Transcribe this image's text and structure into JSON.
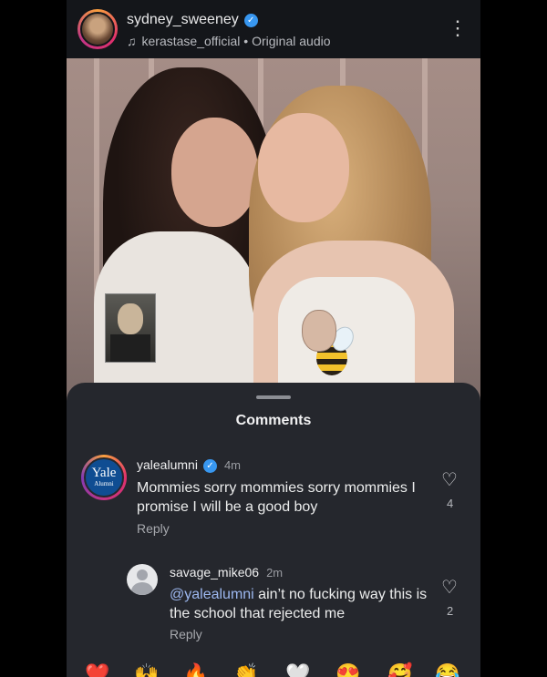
{
  "header": {
    "username": "sydney_sweeney",
    "audio_account": "kerastase_official",
    "audio_separator": " • ",
    "audio_label": "Original audio",
    "note_glyph": "♫",
    "menu_glyph": "⋮",
    "icons": [
      "verified-badge-icon",
      "music-note-icon",
      "more-options-icon"
    ]
  },
  "photo": {
    "stickers": [
      "vintage-portrait-sticker",
      "bee-sticker"
    ]
  },
  "comments": {
    "title": "Comments",
    "items": [
      {
        "user": "yalealumni",
        "time": "4m",
        "text": "Mommies sorry mommies sorry mommies I promise I will be a good boy",
        "reply_label": "Reply",
        "likes": "4",
        "avatar_text_line1": "Yale",
        "avatar_text_line2": "Alumni"
      },
      {
        "user": "savage_mike06",
        "time": "2m",
        "mention": "@yalealumni",
        "text": " ain’t no fucking way this is the school that rejected me",
        "reply_label": "Reply",
        "likes": "2"
      }
    ]
  },
  "emoji_bar": [
    "❤️",
    "🙌",
    "🔥",
    "👏",
    "🤍",
    "😍",
    "🥰",
    "😂"
  ],
  "colors": {
    "background": "#000000",
    "sheet": "#25272d",
    "verified": "#3897f0",
    "mention": "#9db8f0"
  }
}
